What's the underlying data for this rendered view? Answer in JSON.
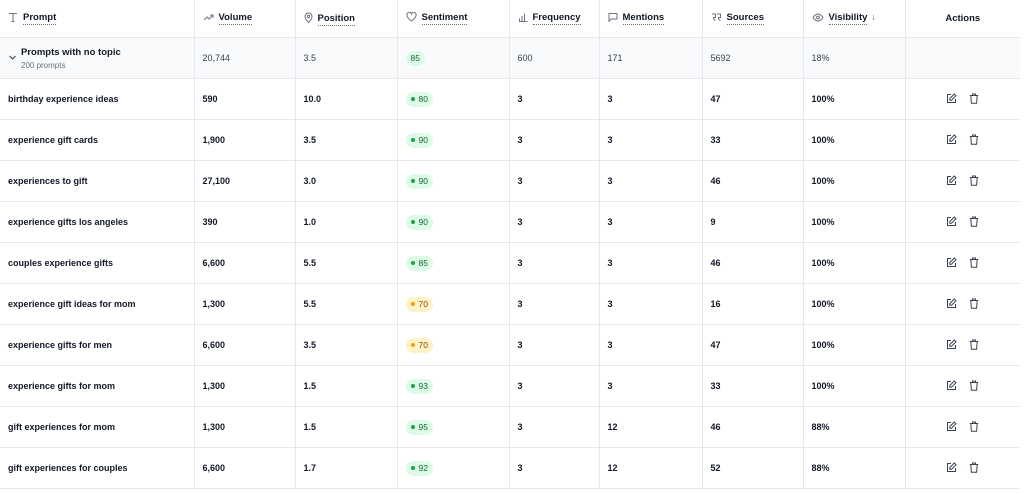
{
  "headers": {
    "prompt": "Prompt",
    "volume": "Volume",
    "position": "Position",
    "sentiment": "Sentiment",
    "frequency": "Frequency",
    "mentions": "Mentions",
    "sources": "Sources",
    "visibility": "Visibility",
    "visibility_sort": "↓",
    "actions": "Actions"
  },
  "group": {
    "title": "Prompts with no topic",
    "subtitle": "200 prompts",
    "volume": "20,744",
    "position": "3.5",
    "sentiment": "85",
    "frequency": "600",
    "mentions": "171",
    "sources": "5692",
    "visibility": "18%"
  },
  "rows": [
    {
      "prompt": "birthday experience ideas",
      "volume": "590",
      "position": "10.0",
      "sentiment": "80",
      "sentiment_level": "green",
      "frequency": "3",
      "mentions": "3",
      "sources": "47",
      "visibility": "100%"
    },
    {
      "prompt": "experience gift cards",
      "volume": "1,900",
      "position": "3.5",
      "sentiment": "90",
      "sentiment_level": "green",
      "frequency": "3",
      "mentions": "3",
      "sources": "33",
      "visibility": "100%"
    },
    {
      "prompt": "experiences to gift",
      "volume": "27,100",
      "position": "3.0",
      "sentiment": "90",
      "sentiment_level": "green",
      "frequency": "3",
      "mentions": "3",
      "sources": "46",
      "visibility": "100%"
    },
    {
      "prompt": "experience gifts los angeles",
      "volume": "390",
      "position": "1.0",
      "sentiment": "90",
      "sentiment_level": "green",
      "frequency": "3",
      "mentions": "3",
      "sources": "9",
      "visibility": "100%"
    },
    {
      "prompt": "couples experience gifts",
      "volume": "6,600",
      "position": "5.5",
      "sentiment": "85",
      "sentiment_level": "green",
      "frequency": "3",
      "mentions": "3",
      "sources": "46",
      "visibility": "100%"
    },
    {
      "prompt": "experience gift ideas for mom",
      "volume": "1,300",
      "position": "5.5",
      "sentiment": "70",
      "sentiment_level": "yellow",
      "frequency": "3",
      "mentions": "3",
      "sources": "16",
      "visibility": "100%"
    },
    {
      "prompt": "experience gifts for men",
      "volume": "6,600",
      "position": "3.5",
      "sentiment": "70",
      "sentiment_level": "yellow",
      "frequency": "3",
      "mentions": "3",
      "sources": "47",
      "visibility": "100%"
    },
    {
      "prompt": "experience gifts for mom",
      "volume": "1,300",
      "position": "1.5",
      "sentiment": "93",
      "sentiment_level": "green",
      "frequency": "3",
      "mentions": "3",
      "sources": "33",
      "visibility": "100%"
    },
    {
      "prompt": "gift experiences for mom",
      "volume": "1,300",
      "position": "1.5",
      "sentiment": "95",
      "sentiment_level": "green",
      "frequency": "3",
      "mentions": "12",
      "sources": "46",
      "visibility": "88%"
    },
    {
      "prompt": "gift experiences for couples",
      "volume": "6,600",
      "position": "1.7",
      "sentiment": "92",
      "sentiment_level": "green",
      "frequency": "3",
      "mentions": "12",
      "sources": "52",
      "visibility": "88%"
    }
  ],
  "colors": {
    "accent_green": "#16a34a",
    "accent_yellow": "#f59e0b",
    "border": "#e5e7eb"
  },
  "icons": {
    "prompt": "text-icon",
    "volume": "trend-up-icon",
    "position": "map-pin-icon",
    "sentiment": "heart-icon",
    "frequency": "bar-chart-icon",
    "mentions": "message-icon",
    "sources": "quote-icon",
    "visibility": "eye-icon",
    "edit": "edit-icon",
    "delete": "trash-icon",
    "expand": "chevron-down-icon"
  }
}
